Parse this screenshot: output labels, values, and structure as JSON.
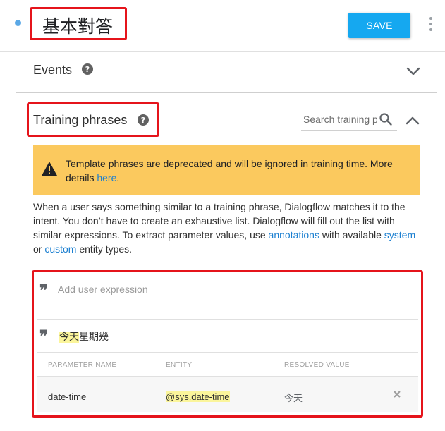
{
  "header": {
    "title": "基本對答",
    "save_label": "SAVE",
    "status_color": "#5aa8e6"
  },
  "events": {
    "label": "Events",
    "help_glyph": "?",
    "help_icon": "help-icon",
    "toggle_icon": "chevron-down-icon"
  },
  "training": {
    "label": "Training phrases",
    "help_glyph": "?",
    "search_placeholder": "Search training phrases",
    "toggle_icon": "chevron-up-icon",
    "warning": {
      "text": "Template phrases are deprecated and will be ignored in training time. More details ",
      "link": "here",
      "suffix": ".",
      "color": "#fbc95e"
    },
    "description": {
      "part1": "When a user says something similar to a training phrase, Dialogflow matches it to the intent. You don’t have to create an exhaustive list. Dialogflow will fill out the list with similar expressions. To extract parameter values, use ",
      "link1": "annotations",
      "part2": " with available ",
      "link2": "system",
      "part3": " or ",
      "link3": "custom",
      "part4": " entity types."
    },
    "add_expression_placeholder": "Add user expression",
    "phrase": {
      "highlighted": "今天",
      "rest": "星期幾"
    },
    "param_table": {
      "headers": [
        "PARAMETER NAME",
        "ENTITY",
        "RESOLVED VALUE"
      ],
      "rows": [
        {
          "name": "date-time",
          "entity": "@sys.date-time",
          "resolved": "今天"
        }
      ]
    }
  },
  "colors": {
    "accent": "#15a8f0",
    "highlight": "#fbf59b",
    "annotation_red": "#e5141b",
    "link": "#1b7fd0"
  }
}
